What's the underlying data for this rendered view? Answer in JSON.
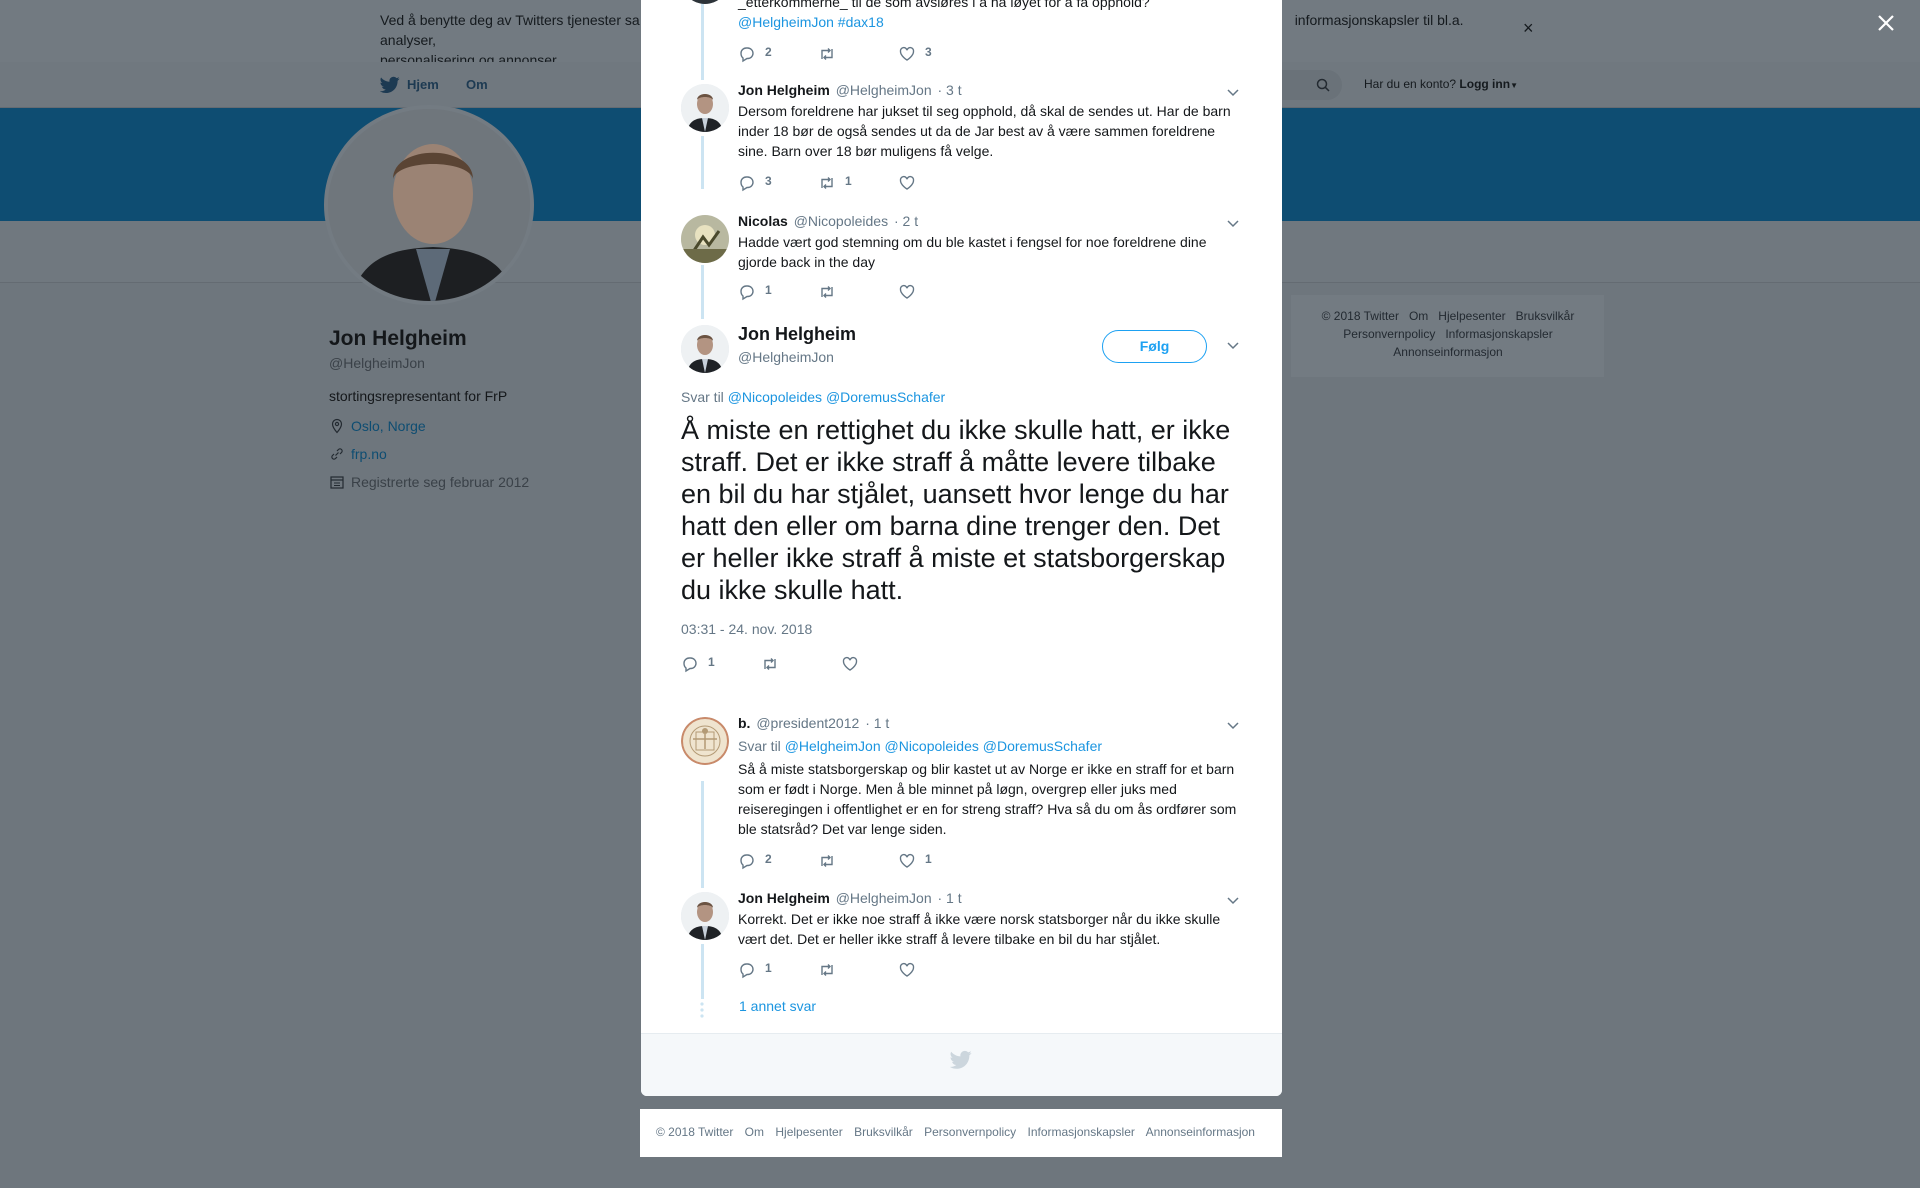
{
  "cookie_bar": {
    "text_start": "Ved å benytte deg av Twitters tjenester sa",
    "text_end": "informasjonskapsler til bl.a. analyser,",
    "text_line2": "personalisering og annonser.",
    "close": "×"
  },
  "nav": {
    "home": "Hjem",
    "about": "Om",
    "account_prompt": "Har du en konto?",
    "login": "Logg inn"
  },
  "profile": {
    "name": "Jon Helgheim",
    "handle": "@HelgheimJon",
    "bio": "stortingsrepresentant for FrP",
    "location": "Oslo, Norge",
    "website": "frp.no",
    "joined": "Registrerte seg februar 2012"
  },
  "sidebar_footer": {
    "items": [
      "© 2018 Twitter",
      "Om",
      "Hjelpesenter",
      "Bruksvilkår",
      "Personvernpolicy",
      "Informasjonskapsler",
      "Annonseinformasjon"
    ]
  },
  "thread": {
    "top_partial": {
      "text_partial": "_etterkommerne_ til de som avsløres i å ha løyet for å få opphold?",
      "links": "@HelgheimJon #dax18",
      "replies": "2",
      "retweets": "",
      "likes": "3"
    },
    "tweets": [
      {
        "name": "Jon Helgheim",
        "handle": "@HelgheimJon",
        "time": "· 3 t",
        "text": "Dersom foreldrene har jukset til seg opphold, då skal de sendes ut. Har de barn inder 18 bør de også sendes ut da de Jar best av å være sammen foreldrene sine. Barn over 18 bør muligens få velge.",
        "replies": "3",
        "retweets": "1",
        "likes": ""
      },
      {
        "name": "Nicolas",
        "handle": "@Nicopoleides",
        "time": "· 2 t",
        "text": "Hadde vært god stemning om du ble kastet i fengsel for noe foreldrene dine gjorde back in the day",
        "replies": "1",
        "retweets": "",
        "likes": ""
      }
    ],
    "main": {
      "name": "Jon Helgheim",
      "handle": "@HelgheimJon",
      "follow": "Følg",
      "reply_to_label": "Svar til",
      "reply_to_handles": "@Nicopoleides @DoremusSchafer",
      "text": "Å miste en rettighet du ikke skulle hatt, er ikke straff. Det er ikke straff å måtte levere tilbake en bil du har stjålet, uansett hvor lenge du har hatt den eller om barna dine trenger den. Det er heller ikke straff å miste et statsborgerskap du ikke skulle hatt.",
      "date": "03:31 - 24. nov. 2018",
      "replies": "1",
      "retweets": "",
      "likes": ""
    },
    "replies": [
      {
        "name": "b.",
        "handle": "@president2012",
        "time": "· 1 t",
        "reply_to_label": "Svar til",
        "reply_to_handles": "@HelgheimJon @Nicopoleides @DoremusSchafer",
        "text": "Så å miste statsborgerskap og blir kastet ut av Norge er ikke en straff for et barn som er født i Norge. Men å ble minnet på løgn, overgrep eller juks med reiseregingen i offentlighet er en for streng straff?  Hva så du om ås ordfører som ble statsråd? Det var lenge siden.",
        "replies": "2",
        "retweets": "",
        "likes": "1"
      },
      {
        "name": "Jon Helgheim",
        "handle": "@HelgheimJon",
        "time": "· 1 t",
        "text": "Korrekt. Det er ikke noe straff å ikke være norsk statsborger når du ikke skulle vært det. Det er heller ikke straff å levere tilbake en bil du har stjålet.",
        "replies": "1",
        "retweets": "",
        "likes": ""
      }
    ],
    "more_replies": "1 annet svar"
  },
  "bottom_footer": {
    "items": [
      "© 2018 Twitter",
      "Om",
      "Hjelpesenter",
      "Bruksvilkår",
      "Personvernpolicy",
      "Informasjonskapsler",
      "Annonseinformasjon"
    ]
  },
  "colors": {
    "twitter_blue": "#1da1f2",
    "link_blue": "#1b95e0",
    "thread_line": "#cce4f2",
    "overlay": "#6e767d"
  }
}
